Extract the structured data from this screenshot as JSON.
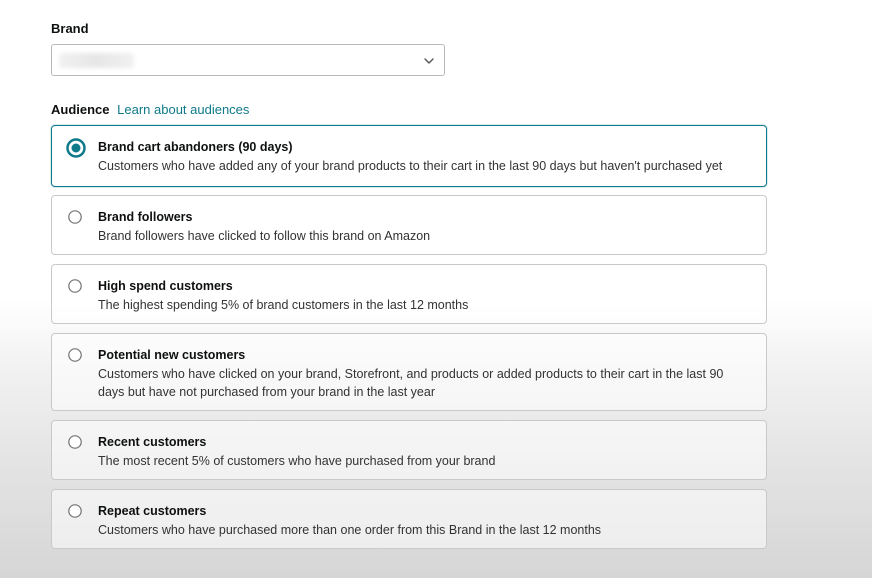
{
  "brand": {
    "label": "Brand",
    "selected_value": ""
  },
  "audience": {
    "label": "Audience",
    "learn_link": "Learn about audiences",
    "options": [
      {
        "title": "Brand cart abandoners (90 days)",
        "description": "Customers who have added any of your brand products to their cart in the last 90 days but haven't purchased yet",
        "selected": true
      },
      {
        "title": "Brand followers",
        "description": "Brand followers have clicked to follow this brand on Amazon",
        "selected": false
      },
      {
        "title": "High spend customers",
        "description": "The highest spending 5% of brand customers in the last 12 months",
        "selected": false
      },
      {
        "title": "Potential new customers",
        "description": "Customers who have clicked on your brand, Storefront, and products or added products to their cart in the last 90 days but have not purchased from your brand in the last year",
        "selected": false
      },
      {
        "title": "Recent customers",
        "description": "The most recent 5% of customers who have purchased from your brand",
        "selected": false
      },
      {
        "title": "Repeat customers",
        "description": "Customers who have purchased more than one order from this Brand in the last 12 months",
        "selected": false
      }
    ]
  },
  "colors": {
    "accent": "#0e7a8a",
    "border": "#c9c9c9",
    "text": "#0f1111"
  }
}
